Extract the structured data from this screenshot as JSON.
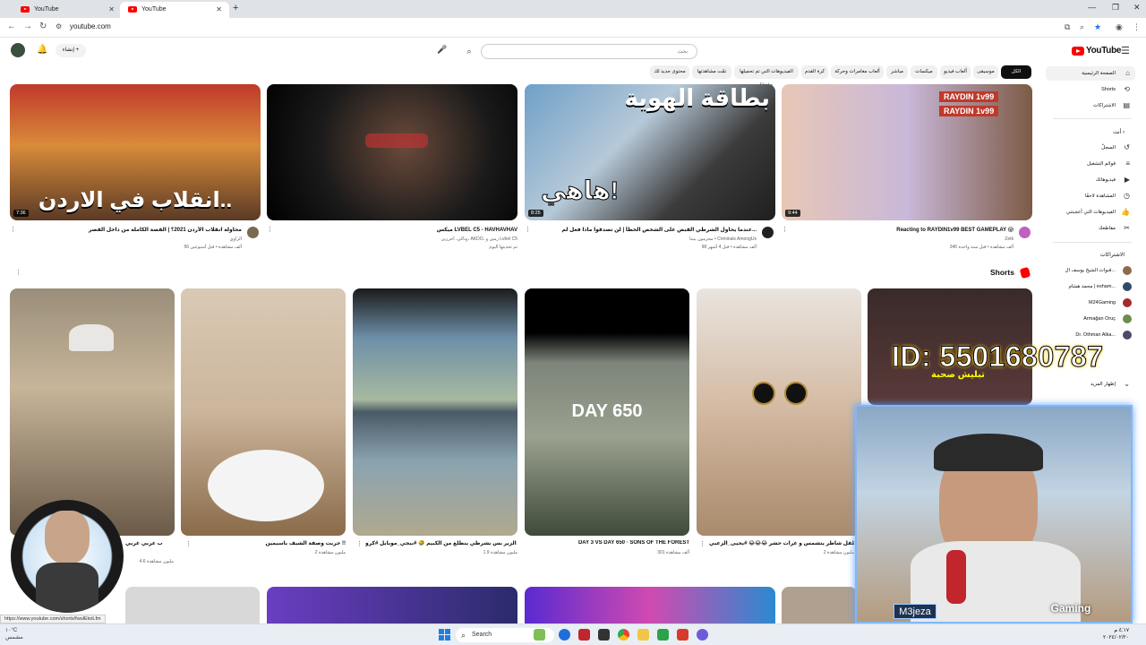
{
  "browser": {
    "tabs": [
      {
        "title": "YouTube",
        "active": false
      },
      {
        "title": "YouTube",
        "active": true
      }
    ],
    "url": "youtube.com",
    "status_url": "https://www.youtube.com/shorts/fwulEtoiLfm"
  },
  "header": {
    "logo_text": "YouTube",
    "search_placeholder": "بحث",
    "search_value": "",
    "create_label": "إنشاء"
  },
  "chips": [
    {
      "label": "الكل",
      "active": true
    },
    {
      "label": "موسيقى",
      "active": false
    },
    {
      "label": "ألعاب فيديو",
      "active": false
    },
    {
      "label": "ميكسات",
      "active": false
    },
    {
      "label": "مباشر",
      "active": false
    },
    {
      "label": "ألعاب مغامرات وحركة",
      "active": false
    },
    {
      "label": "كرة القدم",
      "active": false
    },
    {
      "label": "الفيديوهات التي تم تحميلها مؤخرًا",
      "active": false
    },
    {
      "label": "تمّت مشاهدتها",
      "active": false
    },
    {
      "label": "محتوى جديد لك",
      "active": false
    }
  ],
  "sidebar": {
    "main": [
      {
        "label": "الصفحة الرئيسية",
        "icon": "home-icon",
        "active": true
      },
      {
        "label": "Shorts",
        "icon": "shorts-icon",
        "active": false
      },
      {
        "label": "الاشتراكات",
        "icon": "subscriptions-icon",
        "active": false
      }
    ],
    "you_heading": "أنت",
    "you": [
      {
        "label": "السجلّ",
        "icon": "history-icon"
      },
      {
        "label": "قوائم التشغيل",
        "icon": "playlist-icon"
      },
      {
        "label": "فيديوهاتك",
        "icon": "video-icon"
      },
      {
        "label": "المشاهدة لاحقًا",
        "icon": "clock-icon"
      },
      {
        "label": "الفيديوهات التي أعجبتني",
        "icon": "like-icon"
      },
      {
        "label": "مقاطعك",
        "icon": "scissors-icon"
      }
    ],
    "subs_heading": "الاشتراكات",
    "subs": [
      {
        "label": "قنوات الشيخ يوسف ال...",
        "color": "#8e6b4b"
      },
      {
        "label": "محمد هشام | esham...",
        "color": "#2f4a6b"
      },
      {
        "label": "M24Gaming",
        "color": "#a52a2a"
      },
      {
        "label": "Armağan Oruç",
        "color": "#6b8e4b"
      },
      {
        "label": "Dr. Othman Alka...",
        "color": "#4b4b6b"
      }
    ],
    "show_more": "إظهار المزيد"
  },
  "videos": [
    {
      "title": "محاولة انقلاب الأردن 2021؟ | القصة الكاملة من داخل القصر",
      "channel": "الزاوي",
      "meta": "56 ألف مشاهدة • قبل أسبوعين",
      "duration": "7:36",
      "thumb_text": "انقلاب في الاردن..",
      "avatar": "#7a6a50"
    },
    {
      "title": "ميكس LVBEL C5 - HAVHAVHAV",
      "channel": "وتاكي، أحرزين، AKDO، رمين و Lvbel C5",
      "meta": "تم تحديثها اليوم",
      "duration": "",
      "thumb_text": "",
      "avatar": "#555"
    },
    {
      "title": "عندما يحاول الشرطي القبض على الشخص الخطأ | لن تصدقوا ماذا فعل لم...",
      "channel": "مجرمون بيننا • Criminals AmongUs",
      "meta": "98 ألف مشاهدة • قبل 4 أشهر",
      "duration": "8:25",
      "thumb_text": "هاهي!",
      "thumb_text2": "بطاقة الهوية",
      "avatar": "#222"
    },
    {
      "title": "Reacting to RAYDIN1v99 BEST GAMEPLAY 😱",
      "channel": "Zetti",
      "meta": "346 ألف مشاهدة • قبل سنة واحدة",
      "duration": "9:44",
      "thumb_text": "RAYDIN 1v99",
      "avatar": "#c060c0"
    }
  ],
  "shorts_heading": "Shorts",
  "shorts": [
    {
      "title": "شاب عربي غربي 😂😂 comedy# #الضراب#",
      "views": "4.6 مليون مشاهدة"
    },
    {
      "title": "جربت وصفة الشيف باسيمين !!",
      "views": "2 مليون مشاهدة"
    },
    {
      "title": "أنيق الزير بس بشرطي ينطلع من الكبيم 🤣 #ببجي_موبايل #كرو atro",
      "views": "1.9 مليون مشاهدة"
    },
    {
      "title": "DAY 3 VS DAY 650 · SONS OF THE FOREST",
      "views": "301 ألف مشاهدة",
      "thumb_text": "DAY 650"
    },
    {
      "title": "طفل شاطر يتشمس و غرات حشر 😂😂😂 #يحيى_الزعبي",
      "views": "2 مليون مشاهدة"
    },
    {
      "title": "",
      "views": ""
    }
  ],
  "overlays": {
    "id_text": "ID: 5501680787",
    "id_sub": "تبليش صحبة",
    "streamer_left": "M3jeza",
    "streamer_right": "Gaming"
  },
  "taskbar": {
    "search_label": "Search",
    "weather_line1": "١٠°C",
    "weather_line2": "مشمس",
    "time": "٤:١٧ م",
    "date": "٢٠٢٤/٠٢/٢٠"
  }
}
